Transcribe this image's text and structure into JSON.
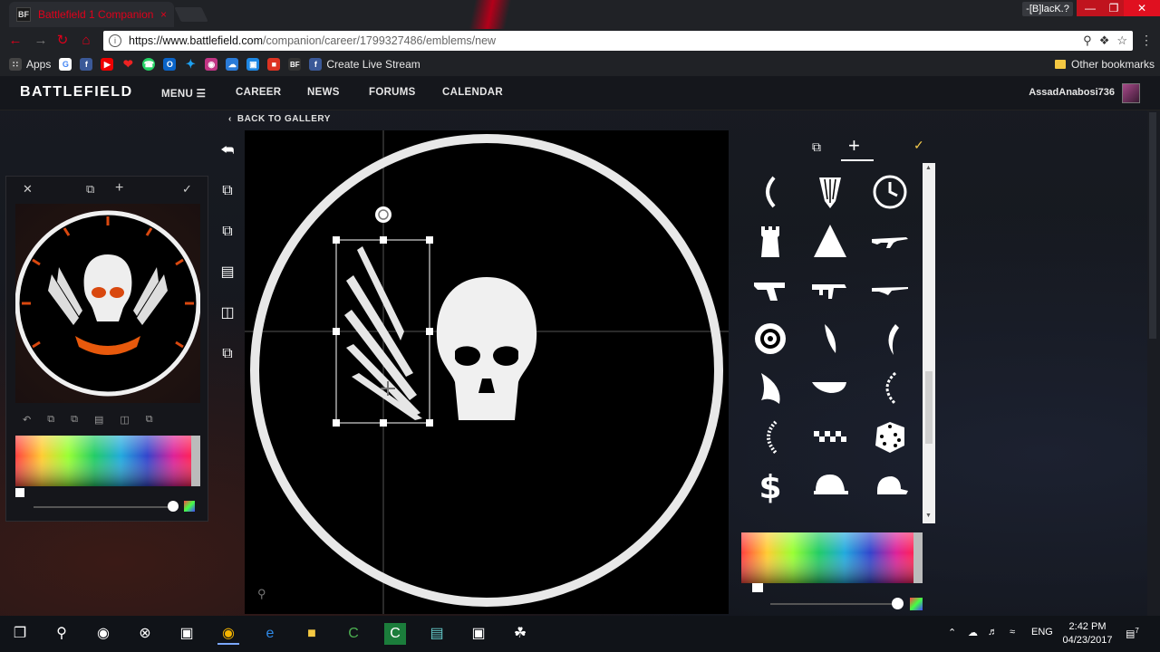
{
  "browser": {
    "tab_title": "Battlefield 1 Companion",
    "tab_favicon": "BF",
    "tab_close": "×",
    "profile_chip": "-[B]lacK.?",
    "url_host": "https://www.battlefield.com",
    "url_path": "/companion/career/1799327486/emblems/new",
    "bookmarks_apps": "Apps",
    "bookmark_bf": "BF",
    "bookmark_live": "Create Live Stream",
    "other_bookmarks": "Other bookmarks"
  },
  "site": {
    "logo": "BATTLEFIELD",
    "nav": {
      "menu": "MENU",
      "career": "CAREER",
      "news": "NEWS",
      "forums": "FORUMS",
      "calendar": "CALENDAR"
    },
    "username": "AssadAnabosi736",
    "back_to_gallery": "BACK TO GALLERY"
  },
  "editor": {
    "right_panel_icons": [
      "copy-layer-icon",
      "add-layer-icon",
      "confirm-icon"
    ],
    "toolbar_icons": [
      "undo-icon",
      "duplicate-icon",
      "move-up-icon",
      "align-icon",
      "flip-icon",
      "move-down-icon"
    ],
    "shapes": [
      "bracket",
      "feather",
      "clock",
      "tower",
      "triangle",
      "rifle-1",
      "pistol",
      "smg",
      "rifle-2",
      "gear-wheel",
      "feather-2",
      "wing-curve",
      "wing",
      "blade",
      "laurel-half",
      "laurel-small",
      "checkers",
      "dice",
      "dollar",
      "helmet",
      "cap"
    ]
  },
  "taskbar": {
    "language": "ENG",
    "time": "2:42 PM",
    "date": "04/23/2017",
    "notifications": "7"
  }
}
